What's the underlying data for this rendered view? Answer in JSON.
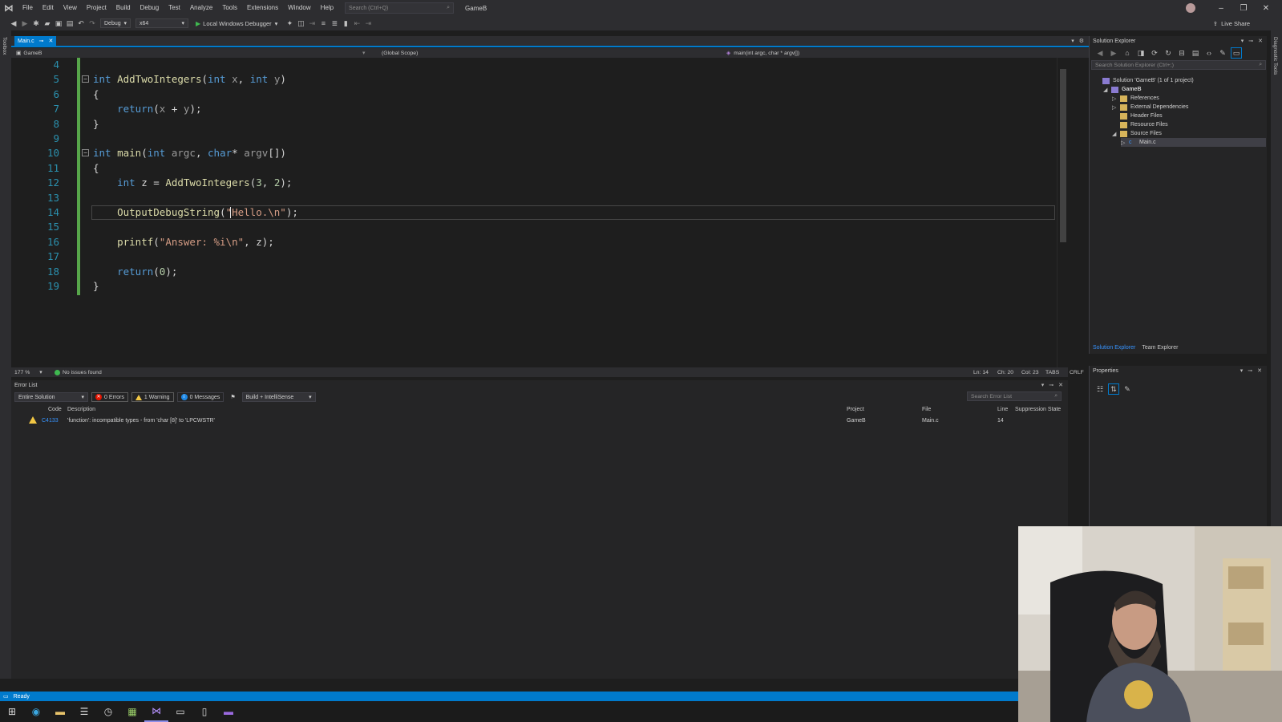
{
  "menu": {
    "items": [
      "File",
      "Edit",
      "View",
      "Project",
      "Build",
      "Debug",
      "Test",
      "Analyze",
      "Tools",
      "Extensions",
      "Window",
      "Help"
    ],
    "search_placeholder": "Search (Ctrl+Q)",
    "solution_name": "GameB"
  },
  "toolbar": {
    "config": "Debug",
    "platform": "x64",
    "run_label": "Local Windows Debugger",
    "live_share": "Live Share"
  },
  "side": {
    "left_label": "Toolbox",
    "right_label": "Diagnostic Tools"
  },
  "editor": {
    "tab_name": "Main.c",
    "nav_project": "GameB",
    "nav_scope": "(Global Scope)",
    "nav_function": "main(int argc, char * argv[])",
    "lines": [
      {
        "n": "4",
        "segs": []
      },
      {
        "n": "5",
        "segs": [
          {
            "t": "int",
            "c": "kw"
          },
          {
            "t": " "
          },
          {
            "t": "AddTwoIntegers",
            "c": "fn"
          },
          {
            "t": "("
          },
          {
            "t": "int",
            "c": "kw"
          },
          {
            "t": " "
          },
          {
            "t": "x",
            "c": "prm"
          },
          {
            "t": ", "
          },
          {
            "t": "int",
            "c": "kw"
          },
          {
            "t": " "
          },
          {
            "t": "y",
            "c": "prm"
          },
          {
            "t": ")"
          }
        ]
      },
      {
        "n": "6",
        "segs": [
          {
            "t": "{"
          }
        ]
      },
      {
        "n": "7",
        "segs": [
          {
            "t": "    return",
            "c": "kw"
          },
          {
            "t": "("
          },
          {
            "t": "x",
            "c": "prm"
          },
          {
            "t": " + "
          },
          {
            "t": "y",
            "c": "prm"
          },
          {
            "t": ");"
          }
        ]
      },
      {
        "n": "8",
        "segs": [
          {
            "t": "}"
          }
        ]
      },
      {
        "n": "9",
        "segs": []
      },
      {
        "n": "10",
        "segs": [
          {
            "t": "int",
            "c": "kw"
          },
          {
            "t": " "
          },
          {
            "t": "main",
            "c": "fn"
          },
          {
            "t": "("
          },
          {
            "t": "int",
            "c": "kw"
          },
          {
            "t": " "
          },
          {
            "t": "argc",
            "c": "prm"
          },
          {
            "t": ", "
          },
          {
            "t": "char",
            "c": "kw"
          },
          {
            "t": "* "
          },
          {
            "t": "argv",
            "c": "prm"
          },
          {
            "t": "[])"
          }
        ]
      },
      {
        "n": "11",
        "segs": [
          {
            "t": "{"
          }
        ]
      },
      {
        "n": "12",
        "segs": [
          {
            "t": "    int",
            "c": "kw"
          },
          {
            "t": " z = "
          },
          {
            "t": "AddTwoIntegers",
            "c": "fn"
          },
          {
            "t": "("
          },
          {
            "t": "3",
            "c": "num"
          },
          {
            "t": ", "
          },
          {
            "t": "2",
            "c": "num"
          },
          {
            "t": ");"
          }
        ]
      },
      {
        "n": "13",
        "segs": []
      },
      {
        "n": "14",
        "segs": [
          {
            "t": "    OutputDebugString",
            "c": "fn"
          },
          {
            "t": "("
          },
          {
            "t": "\"Hello.\\n\"",
            "c": "str"
          },
          {
            "t": ");"
          }
        ]
      },
      {
        "n": "15",
        "segs": []
      },
      {
        "n": "16",
        "segs": [
          {
            "t": "    printf",
            "c": "fn"
          },
          {
            "t": "("
          },
          {
            "t": "\"Answer: %i\\n\"",
            "c": "str"
          },
          {
            "t": ", z);"
          }
        ]
      },
      {
        "n": "17",
        "segs": []
      },
      {
        "n": "18",
        "segs": [
          {
            "t": "    return",
            "c": "kw"
          },
          {
            "t": "("
          },
          {
            "t": "0",
            "c": "num"
          },
          {
            "t": ");"
          }
        ]
      },
      {
        "n": "19",
        "segs": [
          {
            "t": "}"
          }
        ]
      }
    ]
  },
  "editor_status": {
    "zoom": "177 %",
    "issues": "No issues found",
    "ln": "Ln: 14",
    "ch": "Ch: 20",
    "col": "Col: 23",
    "tabs": "TABS",
    "eol": "CRLF"
  },
  "error_list": {
    "title": "Error List",
    "scope": "Entire Solution",
    "errors": "0 Errors",
    "warnings": "1 Warning",
    "messages": "0 Messages",
    "source": "Build + IntelliSense",
    "search_placeholder": "Search Error List",
    "columns": [
      "Code",
      "Description",
      "Project",
      "File",
      "Line",
      "Suppression State"
    ],
    "rows": [
      {
        "code": "C4133",
        "description": "'function': incompatible types - from 'char [8]' to 'LPCWSTR'",
        "project": "GameB",
        "file": "Main.c",
        "line": "14",
        "state": ""
      }
    ]
  },
  "solution_explorer": {
    "title": "Solution Explorer",
    "search_placeholder": "Search Solution Explorer (Ctrl+;)",
    "tree": [
      {
        "label": "Solution 'GameB' (1 of 1 project)",
        "depth": 0,
        "arrow": ""
      },
      {
        "label": "GameB",
        "depth": 1,
        "arrow": "◢",
        "bold": true
      },
      {
        "label": "References",
        "depth": 2,
        "arrow": "▷"
      },
      {
        "label": "External Dependencies",
        "depth": 2,
        "arrow": "▷"
      },
      {
        "label": "Header Files",
        "depth": 2,
        "arrow": ""
      },
      {
        "label": "Resource Files",
        "depth": 2,
        "arrow": ""
      },
      {
        "label": "Source Files",
        "depth": 2,
        "arrow": "◢"
      },
      {
        "label": "Main.c",
        "depth": 3,
        "arrow": "▷",
        "selected": true
      }
    ],
    "tab_solution": "Solution Explorer",
    "tab_team": "Team Explorer"
  },
  "properties": {
    "title": "Properties"
  },
  "statusbar": {
    "text": "Ready"
  },
  "colors": {
    "accent": "#007acc",
    "keyword": "#569cd6",
    "function": "#dcdcaa",
    "string": "#d69d85",
    "line_number": "#2b91af",
    "change_bar": "#57a64a",
    "warning": "#f2c744",
    "error": "#e51400"
  }
}
